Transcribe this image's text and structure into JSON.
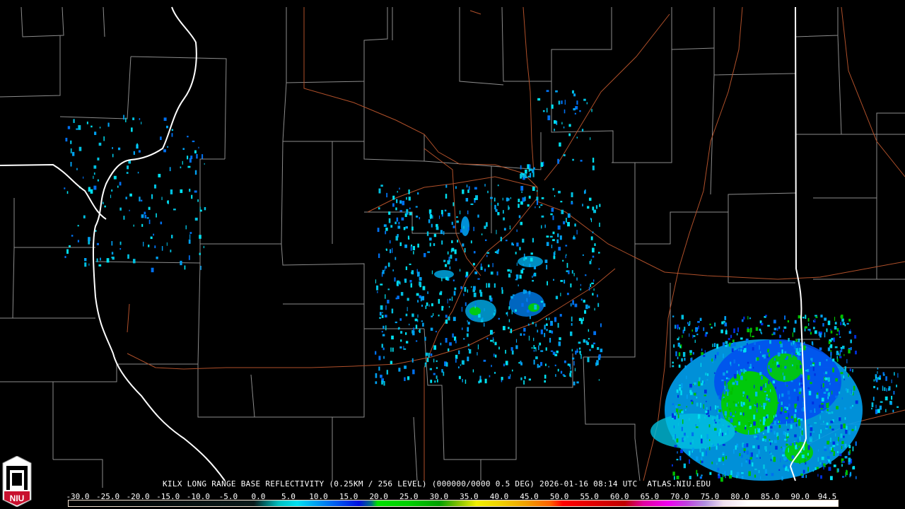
{
  "title": "KILX LONG RANGE BASE REFLECTIVITY (0.25KM / 256 LEVEL) (000000/0000 0.5 DEG) 2026-01-16 08:14 UTC  ATLAS.NIU.EDU",
  "logo_text": "NIU",
  "colorbar": {
    "min": -30,
    "max": 94.5,
    "labels": [
      "-30.0",
      "-25.0",
      "-20.0",
      "-15.0",
      "-10.0",
      "-5.0",
      "0.0",
      "5.0",
      "10.0",
      "15.0",
      "20.0",
      "25.0",
      "30.0",
      "35.0",
      "40.0",
      "45.0",
      "50.0",
      "55.0",
      "60.0",
      "65.0",
      "70.0",
      "75.0",
      "80.0",
      "85.0",
      "90.0",
      "94.5"
    ],
    "stops": [
      [
        -30,
        "#000000"
      ],
      [
        0,
        "#0a1a1a"
      ],
      [
        2,
        "#007070"
      ],
      [
        4,
        "#00c0c0"
      ],
      [
        7,
        "#00e0f0"
      ],
      [
        10,
        "#00a0f0"
      ],
      [
        13,
        "#0060f0"
      ],
      [
        17,
        "#0010e0"
      ],
      [
        19,
        "#007080"
      ],
      [
        20,
        "#00e000"
      ],
      [
        25,
        "#00d000"
      ],
      [
        30,
        "#00a000"
      ],
      [
        33,
        "#80c000"
      ],
      [
        36,
        "#f0f000"
      ],
      [
        40,
        "#f0d000"
      ],
      [
        44,
        "#f0a000"
      ],
      [
        48,
        "#ff6000"
      ],
      [
        50,
        "#ff0000"
      ],
      [
        55,
        "#e00000"
      ],
      [
        60,
        "#c00000"
      ],
      [
        63,
        "#e000a0"
      ],
      [
        67,
        "#f000f0"
      ],
      [
        70,
        "#c040e0"
      ],
      [
        73,
        "#b090e0"
      ],
      [
        76,
        "#f0e0f0"
      ],
      [
        80,
        "#ffffff"
      ],
      [
        94.5,
        "#ffffff"
      ]
    ]
  },
  "colors": {
    "county": "#8c8c8c",
    "highway": "#b0502a",
    "state": "#ffffff"
  }
}
